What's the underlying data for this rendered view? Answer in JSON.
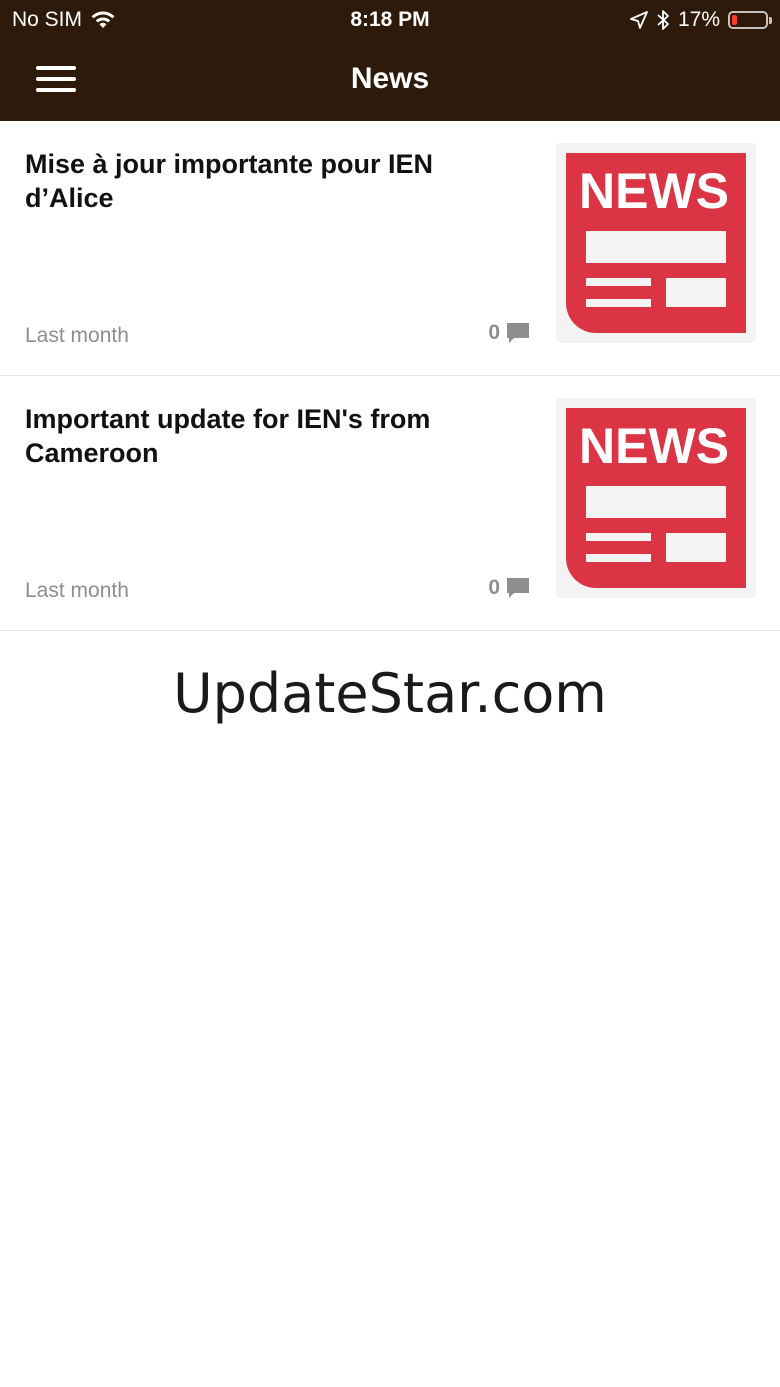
{
  "status_bar": {
    "carrier": "No SIM",
    "time": "8:18 PM",
    "battery": "17%",
    "battery_level": 0.17,
    "icons": [
      "wifi-icon",
      "location-arrow-icon",
      "bluetooth-icon",
      "battery-icon"
    ]
  },
  "header": {
    "title": "News",
    "menu_icon": "hamburger-menu-icon",
    "background": "#2e1a0b"
  },
  "articles": [
    {
      "title": "Mise à jour importante pour IEN d’Alice",
      "date": "Last month",
      "comments": "0",
      "thumbnail_text": "NEWS"
    },
    {
      "title": "Important update for IEN's from Cameroon",
      "date": "Last month",
      "comments": "0",
      "thumbnail_text": "NEWS"
    }
  ],
  "watermark": "UpdateStar.com",
  "colors": {
    "news_red": "#db3545",
    "meta_gray": "#8e8e8e"
  }
}
